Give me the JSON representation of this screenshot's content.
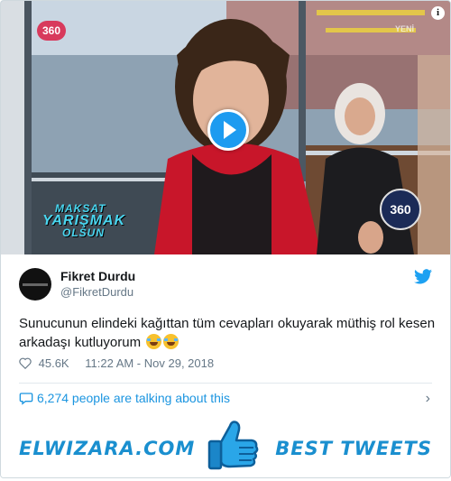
{
  "media": {
    "channel_logo": "360",
    "corner_tag": "YENİ",
    "show_title": [
      "MAKSAT",
      "YARIŞMAK",
      "OLSUN"
    ],
    "mic_label": "360",
    "info_icon": "info-icon",
    "play_icon": "play-icon"
  },
  "tweet": {
    "author_name": "Fikret Durdu",
    "author_handle": "@FikretDurdu",
    "text": "Sunucunun elindeki kağıttan tüm cevapları okuyarak müthiş rol kesen arkadaşı kutluyorum",
    "emojis": [
      "face-with-tears-of-joy",
      "face-with-tears-of-joy"
    ],
    "likes": "45.6K",
    "timestamp": "11:22 AM - Nov 29, 2018",
    "talking": "6,274 people are talking about this"
  },
  "banner": {
    "left_text": "ELWIZARA.COM",
    "right_text": "BEST TWEETS",
    "thumb_icon": "thumbs-up-icon"
  },
  "colors": {
    "twitter_blue": "#1d9bf0",
    "banner_blue": "#1a8fcf",
    "text": "#14171a",
    "muted": "#657786"
  }
}
